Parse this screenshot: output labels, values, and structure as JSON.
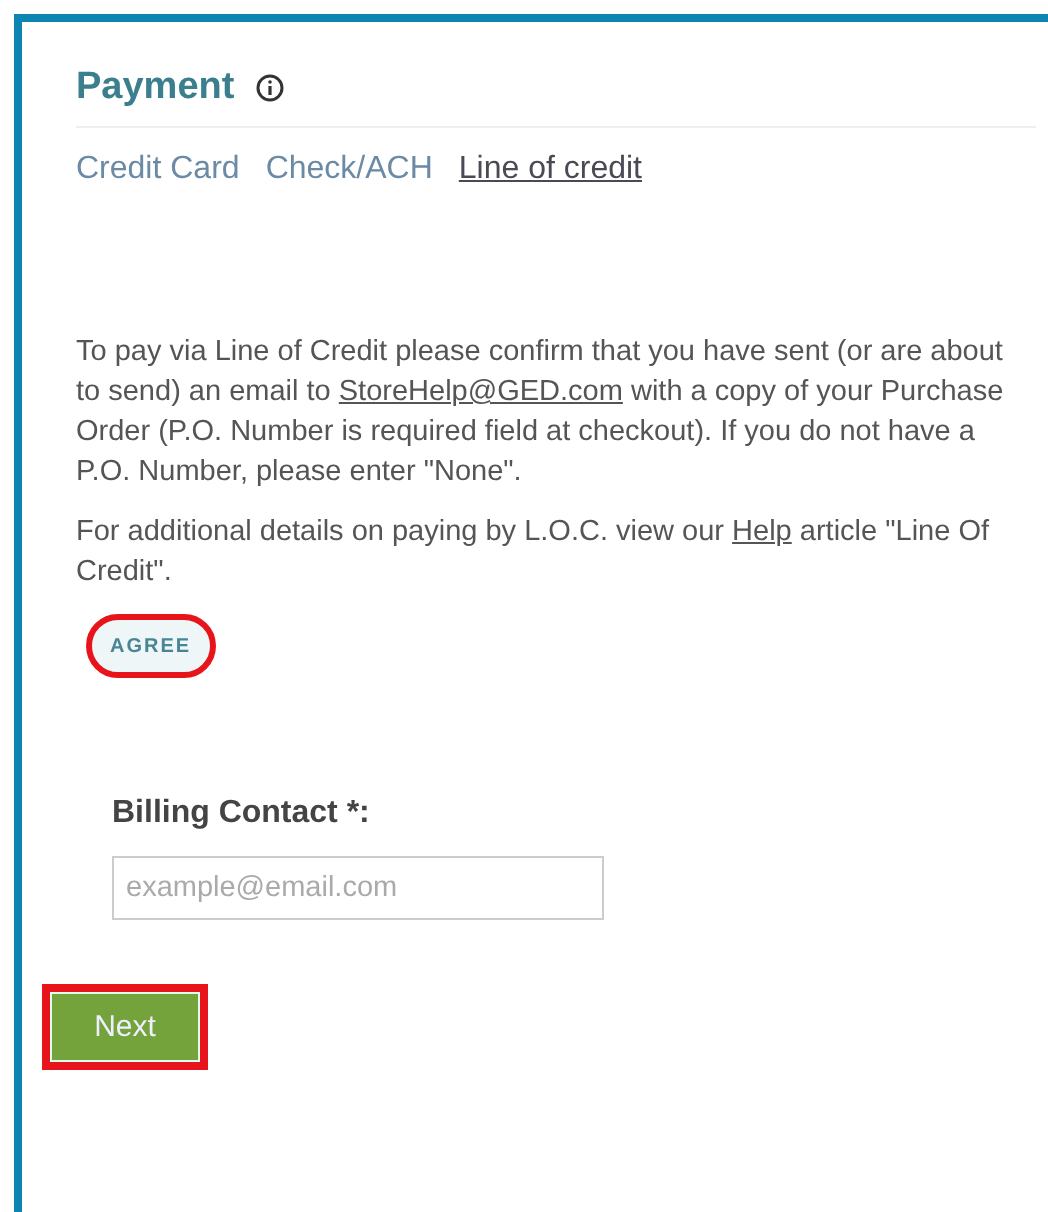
{
  "title": "Payment",
  "tabs": [
    {
      "label": "Credit Card",
      "selected": false
    },
    {
      "label": "Check/ACH",
      "selected": false
    },
    {
      "label": "Line of credit",
      "selected": true
    }
  ],
  "paragraphs": [
    {
      "before": "To pay via Line of Credit please confirm that you have sent (or are about to send) an email to ",
      "link": "StoreHelp@GED.com",
      "after": " with a copy of your Purchase Order (P.O. Number is required field at checkout). If you do not have a P.O. Number, please enter \"None\"."
    },
    {
      "before": "For additional details on paying by L.O.C. view our ",
      "link": "Help",
      "after": " article \"Line Of Credit\"."
    }
  ],
  "agree": {
    "label": "AGREE",
    "highlighted": true
  },
  "billing": {
    "label": "Billing Contact *:",
    "placeholder": "example@email.com"
  },
  "next": {
    "label": "Next",
    "highlighted": true
  }
}
